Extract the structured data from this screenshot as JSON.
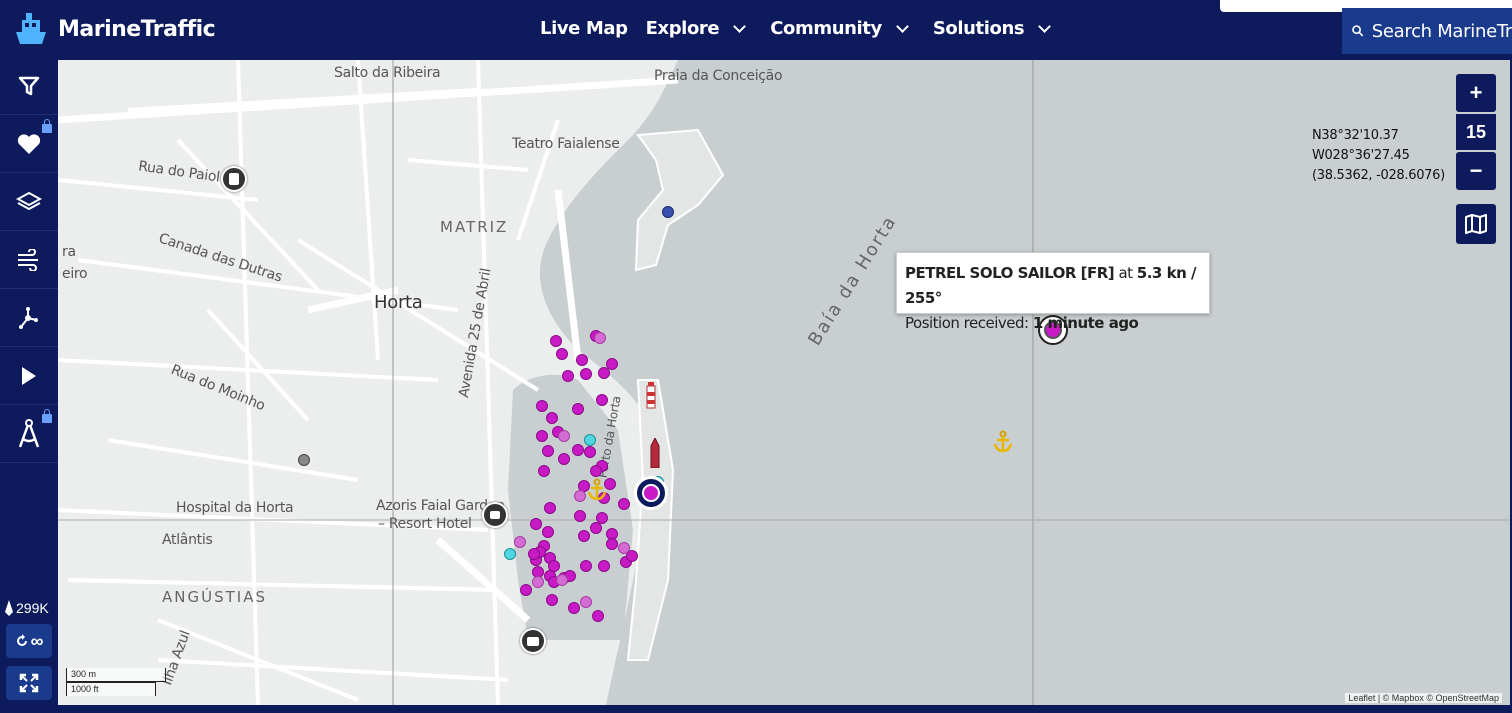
{
  "header": {
    "brand": "MarineTraffic",
    "nav": [
      {
        "label": "Live Map",
        "has_menu": false
      },
      {
        "label": "Explore",
        "has_menu": true
      },
      {
        "label": "Community",
        "has_menu": true
      },
      {
        "label": "Solutions",
        "has_menu": true
      }
    ],
    "search_text": "Search MarineTr"
  },
  "sidebar": {
    "buttons": [
      "filter-icon",
      "heart-icon",
      "layers-icon",
      "wind-icon",
      "route-icon",
      "play-icon",
      "compass-icon"
    ],
    "vessel_count": "299K",
    "loop_label": "∞"
  },
  "map": {
    "zoom_in": "+",
    "zoom_level": "15",
    "zoom_out": "−",
    "coords": {
      "lat": "N38°32'10.37",
      "lon": "W028°36'27.45",
      "decimal": "(38.5362, -028.6076)"
    },
    "labels": {
      "salto": "Salto da Ribeira",
      "praia": "Praia da Conceição",
      "teatro": "Teatro Faialense",
      "paiol": "Rua do Paiol",
      "matriz": "MATRIZ",
      "canada": "Canada das Dutras",
      "horta": "Horta",
      "eiro": "eiro",
      "ra": "ra",
      "avenida": "Avenida 25 de Abril",
      "baia": "Baía da Horta",
      "moinho": "Rua do Moinho",
      "porto": "Porto da Horta",
      "hospital": "Hospital da Horta",
      "azoris1": "Azoris Faial Garden",
      "azoris2": "– Resort Hotel",
      "atlantis": "Atlântis",
      "angustias": "ANGÚSTIAS",
      "ilha": "Ilha Azul"
    },
    "tooltip": {
      "vessel_name": "PETREL SOLO SAILOR [FR]",
      "at": "at",
      "speed_course": "5.3 kn / 255°",
      "pos_label": "Position received:",
      "pos_value": "1 minute ago"
    },
    "scale": {
      "metric": "300 m",
      "imperial": "1000 ft"
    },
    "attribution": "Leaflet | © Mapbox © OpenStreetMap"
  },
  "colors": {
    "navy": "#0d1a5c",
    "vessel": "#c81bc6",
    "water": "#c9cfd1",
    "land": "#eceeee"
  }
}
